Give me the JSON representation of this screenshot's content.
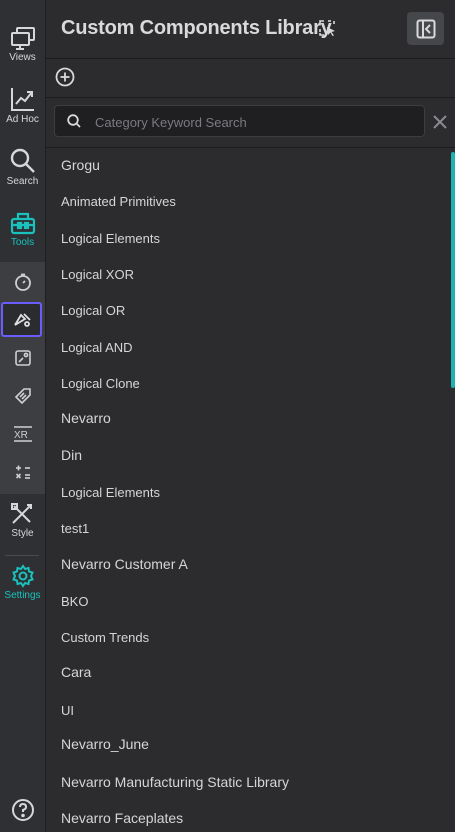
{
  "nav": {
    "views": "Views",
    "adhoc": "Ad Hoc",
    "search": "Search",
    "tools": "Tools",
    "style": "Style",
    "settings": "Settings"
  },
  "colors": {
    "accent": "#19c2bd",
    "selected_border": "#6b5cff",
    "panel_bg": "#2c2c2f"
  },
  "panel": {
    "title": "Custom Components Library",
    "search_placeholder": "Category Keyword Search",
    "items": [
      "Grogu",
      "Animated Primitives",
      "Logical Elements",
      "Logical XOR",
      "Logical OR",
      "Logical AND",
      "Logical Clone",
      "Nevarro",
      "Din",
      "Logical Elements",
      "test1",
      "Nevarro Customer A",
      "BKO",
      "Custom Trends",
      "Cara",
      "UI",
      "Nevarro_June",
      "Nevarro Manufacturing Static Library",
      "Nevarro Faceplates"
    ]
  }
}
